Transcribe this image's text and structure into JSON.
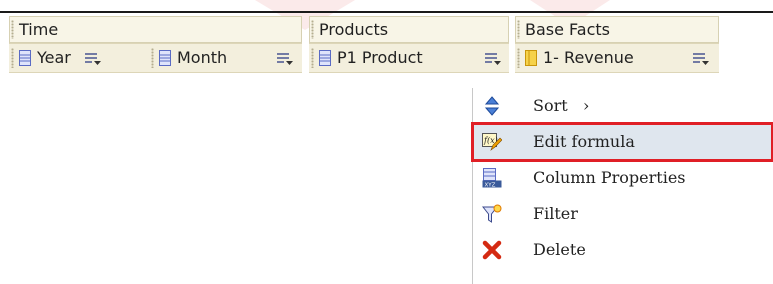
{
  "groups": [
    {
      "label": "Time"
    },
    {
      "label": "Products"
    },
    {
      "label": "Base Facts"
    }
  ],
  "columns": [
    {
      "label": "Year",
      "icon": "attribute-column-icon"
    },
    {
      "label": "Month",
      "icon": "attribute-column-icon"
    },
    {
      "label": "P1 Product",
      "icon": "attribute-column-icon"
    },
    {
      "label": "1- Revenue",
      "icon": "measure-column-icon"
    }
  ],
  "context_menu": {
    "items": [
      {
        "label": "Sort",
        "submenu_arrow": "›",
        "icon": "sort-icon"
      },
      {
        "label": "Edit formula",
        "icon": "edit-formula-icon",
        "highlighted": true
      },
      {
        "label": "Column Properties",
        "icon": "column-properties-icon"
      },
      {
        "label": "Filter",
        "icon": "filter-icon"
      },
      {
        "label": "Delete",
        "icon": "delete-icon"
      }
    ]
  },
  "colors": {
    "header_bg": "#f8f5e7",
    "highlight_border": "#e01f26",
    "highlight_bg": "#dfe6ee",
    "attribute_icon": "#5a6bc4",
    "measure_icon": "#e8b820"
  }
}
